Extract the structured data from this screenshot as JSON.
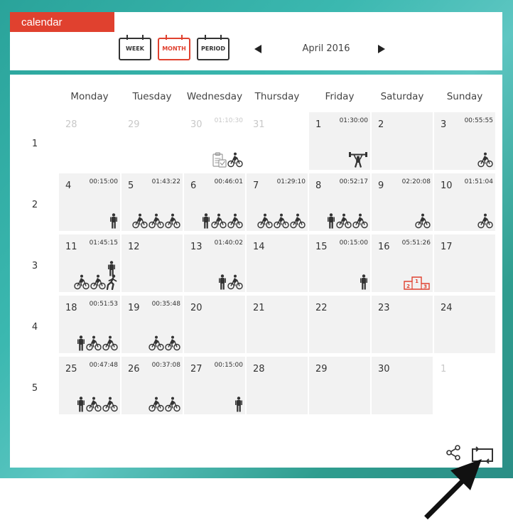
{
  "header": {
    "tab_label": "calendar",
    "views": [
      {
        "label": "WEEK",
        "active": false
      },
      {
        "label": "MONTH",
        "active": true
      },
      {
        "label": "PERIOD",
        "active": false
      }
    ],
    "month_label": "April 2016"
  },
  "colors": {
    "accent": "#e0412f",
    "cell_bg": "#f2f2f2",
    "other_month_text": "#c8c8c8",
    "icon": "#333333"
  },
  "calendar": {
    "day_headers": [
      "Monday",
      "Tuesday",
      "Wednesday",
      "Thursday",
      "Friday",
      "Saturday",
      "Sunday"
    ],
    "weeks": [
      {
        "num": "1",
        "days": [
          {
            "date": "28",
            "other": true,
            "duration": "",
            "icons": []
          },
          {
            "date": "29",
            "other": true,
            "duration": "",
            "icons": []
          },
          {
            "date": "30",
            "other": true,
            "duration": "01:10:30",
            "icons": [
              "clipboard",
              "bike"
            ]
          },
          {
            "date": "31",
            "other": true,
            "duration": "",
            "icons": []
          },
          {
            "date": "1",
            "other": false,
            "duration": "01:30:00",
            "icons": [
              "weightlift"
            ]
          },
          {
            "date": "2",
            "other": false,
            "duration": "",
            "icons": []
          },
          {
            "date": "3",
            "other": false,
            "duration": "00:55:55",
            "icons": [
              "bike"
            ]
          }
        ]
      },
      {
        "num": "2",
        "days": [
          {
            "date": "4",
            "other": false,
            "duration": "00:15:00",
            "icons": [
              "walk"
            ]
          },
          {
            "date": "5",
            "other": false,
            "duration": "01:43:22",
            "icons": [
              "bike",
              "bike",
              "bike"
            ]
          },
          {
            "date": "6",
            "other": false,
            "duration": "00:46:01",
            "icons": [
              "walk",
              "bike",
              "bike"
            ]
          },
          {
            "date": "7",
            "other": false,
            "duration": "01:29:10",
            "icons": [
              "bike",
              "bike",
              "bike"
            ]
          },
          {
            "date": "8",
            "other": false,
            "duration": "00:52:17",
            "icons": [
              "walk",
              "bike",
              "bike"
            ]
          },
          {
            "date": "9",
            "other": false,
            "duration": "02:20:08",
            "icons": [
              "bike"
            ]
          },
          {
            "date": "10",
            "other": false,
            "duration": "01:51:04",
            "icons": [
              "bike"
            ]
          }
        ]
      },
      {
        "num": "3",
        "days": [
          {
            "date": "11",
            "other": false,
            "duration": "01:45:15",
            "icons": [
              "bike",
              "bike",
              "run"
            ],
            "icons_up": [
              "walk"
            ]
          },
          {
            "date": "12",
            "other": false,
            "duration": "",
            "icons": []
          },
          {
            "date": "13",
            "other": false,
            "duration": "01:40:02",
            "icons": [
              "walk",
              "bike"
            ]
          },
          {
            "date": "14",
            "other": false,
            "duration": "",
            "icons": []
          },
          {
            "date": "15",
            "other": false,
            "duration": "00:15:00",
            "icons": [
              "walk"
            ]
          },
          {
            "date": "16",
            "other": false,
            "duration": "05:51:26",
            "icons": [
              "podium"
            ]
          },
          {
            "date": "17",
            "other": false,
            "duration": "",
            "icons": []
          }
        ]
      },
      {
        "num": "4",
        "days": [
          {
            "date": "18",
            "other": false,
            "duration": "00:51:53",
            "icons": [
              "walk",
              "bike",
              "bike"
            ]
          },
          {
            "date": "19",
            "other": false,
            "duration": "00:35:48",
            "icons": [
              "bike",
              "bike"
            ]
          },
          {
            "date": "20",
            "other": false,
            "duration": "",
            "icons": []
          },
          {
            "date": "21",
            "other": false,
            "duration": "",
            "icons": []
          },
          {
            "date": "22",
            "other": false,
            "duration": "",
            "icons": []
          },
          {
            "date": "23",
            "other": false,
            "duration": "",
            "icons": []
          },
          {
            "date": "24",
            "other": false,
            "duration": "",
            "icons": []
          }
        ]
      },
      {
        "num": "5",
        "days": [
          {
            "date": "25",
            "other": false,
            "duration": "00:47:48",
            "icons": [
              "walk",
              "bike",
              "bike"
            ]
          },
          {
            "date": "26",
            "other": false,
            "duration": "00:37:08",
            "icons": [
              "bike",
              "bike"
            ]
          },
          {
            "date": "27",
            "other": false,
            "duration": "00:15:00",
            "icons": [
              "walk"
            ]
          },
          {
            "date": "28",
            "other": false,
            "duration": "",
            "icons": []
          },
          {
            "date": "29",
            "other": false,
            "duration": "",
            "icons": []
          },
          {
            "date": "30",
            "other": false,
            "duration": "",
            "icons": []
          },
          {
            "date": "1",
            "other": true,
            "duration": "",
            "icons": []
          }
        ]
      }
    ]
  },
  "podium_labels": [
    "1",
    "2",
    "3"
  ],
  "toolbar": {
    "share_icon": "share-icon",
    "sync_icon": "sync-icon"
  }
}
